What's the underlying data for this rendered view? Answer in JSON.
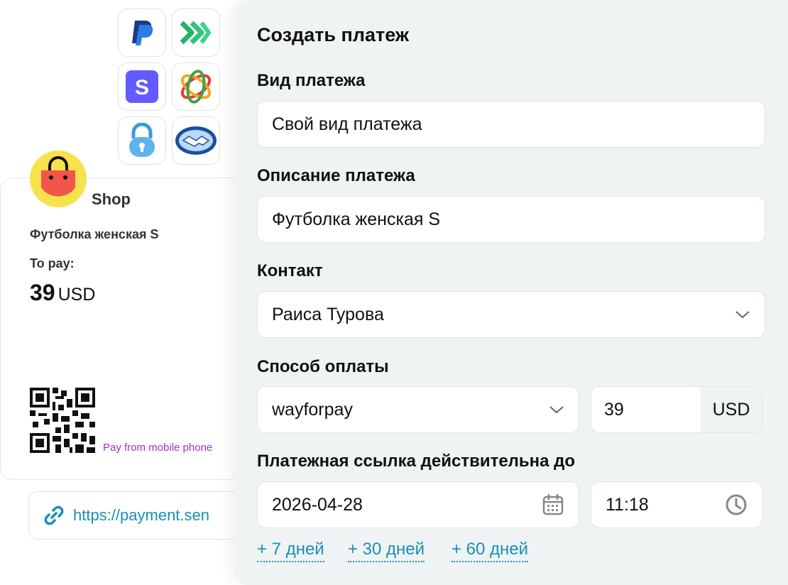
{
  "providers": [
    {
      "name": "paypal-icon"
    },
    {
      "name": "green-arrows-icon"
    },
    {
      "name": "stripe-icon"
    },
    {
      "name": "colorful-rings-icon"
    },
    {
      "name": "lock-icon"
    },
    {
      "name": "handshake-icon"
    }
  ],
  "shop_card": {
    "shop_name": "Shop",
    "product": "Футболка женская S",
    "to_pay_label": "To pay:",
    "amount_value": "39",
    "amount_currency": "USD",
    "mobile_text": "Pay from mobile phone",
    "link_text": "https://payment.sen"
  },
  "form": {
    "title": "Создать платеж",
    "payment_type_label": "Вид платежа",
    "payment_type_value": "Свой вид платежа",
    "description_label": "Описание платежа",
    "description_value": "Футболка женская S",
    "contact_label": "Контакт",
    "contact_value": "Раиса Турова",
    "method_label": "Способ оплаты",
    "method_value": "wayforpay",
    "amount_value": "39",
    "currency": "USD",
    "valid_until_label": "Платежная ссылка действительна до",
    "date_value": "2026-04-28",
    "time_value": "11:18",
    "quick_options": [
      "+ 7 дней",
      "+ 30 дней",
      "+ 60 дней"
    ]
  },
  "colors": {
    "panel_bg": "#eff3f4",
    "link": "#1890b4",
    "mobile_text": "#a030c8"
  }
}
